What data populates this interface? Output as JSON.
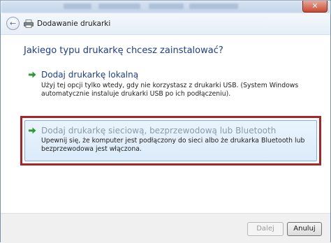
{
  "window": {
    "close_glyph": "✕"
  },
  "nav": {
    "back_glyph": "←",
    "title": "Dodawanie drukarki"
  },
  "heading": "Jakiego typu drukarkę chcesz zainstalować?",
  "options": [
    {
      "title": "Dodaj drukarkę lokalną",
      "description": "Użyj tej opcji tylko wtedy, gdy nie korzystasz z drukarki USB. (System Windows automatycznie instaluje drukarki USB po ich podłączeniu).",
      "icon": "green-arrow-icon",
      "title_color": "#1e3c96"
    },
    {
      "title": "Dodaj drukarkę sieciową, bezprzewodową lub Bluetooth",
      "description": "Upewnij się, że komputer jest podłączony do sieci albo że drukarka Bluetooth lub bezprzewodowa jest włączona.",
      "icon": "green-arrow-icon",
      "title_color": "#8c9aa8",
      "highlight_color": "#a6242a",
      "selected": true
    }
  ],
  "footer": {
    "next_label": "Dalej",
    "cancel_label": "Anuluj"
  },
  "colors": {
    "accent_text": "#1e3c96",
    "highlight_frame": "#a6242a",
    "arrow_green": "#2e9b2e"
  }
}
